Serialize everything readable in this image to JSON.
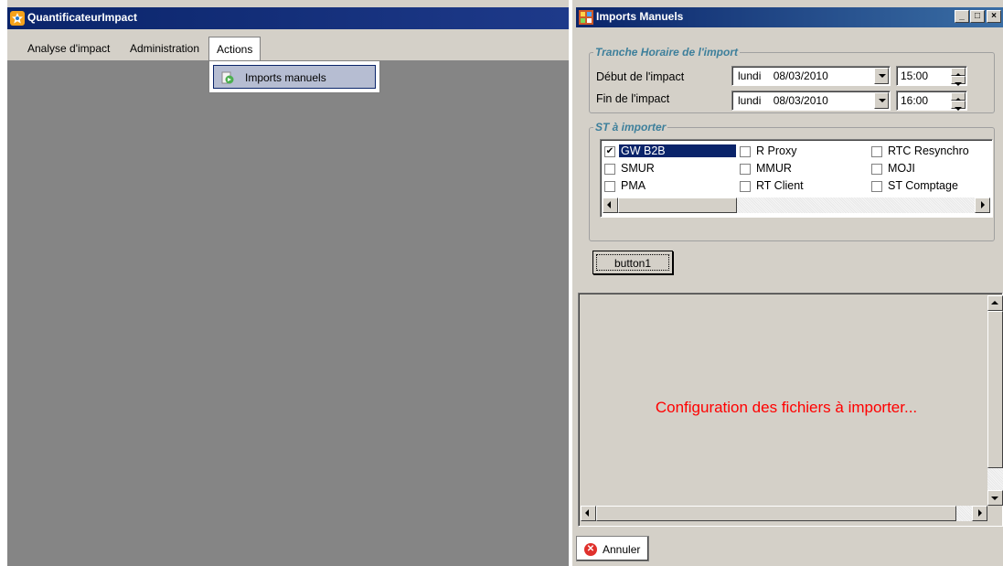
{
  "main_window": {
    "title": "QuantificateurImpact",
    "menu": [
      {
        "label": "Analyse d'impact"
      },
      {
        "label": "Administration"
      },
      {
        "label": "Actions"
      }
    ],
    "actions_menu": {
      "items": [
        {
          "label": "Imports manuels",
          "icon": "import-arrow-icon"
        }
      ]
    }
  },
  "dialog": {
    "title": "Imports Manuels",
    "caption_buttons": {
      "minimize": "_",
      "maximize": "□",
      "close": "×"
    },
    "time_group": {
      "legend": "Tranche Horaire de l'import",
      "start_label": "Début de l'impact",
      "start_date": "lundi    08/03/2010",
      "start_time": "15:00",
      "end_label": "Fin de l'impact",
      "end_date": "lundi    08/03/2010",
      "end_time": "16:00"
    },
    "st_group": {
      "legend": "ST à importer",
      "items": [
        {
          "label": "GW B2B",
          "checked": true,
          "selected": true
        },
        {
          "label": "R Proxy",
          "checked": false
        },
        {
          "label": "RTC Resynchro",
          "checked": false
        },
        {
          "label": "SMUR",
          "checked": false
        },
        {
          "label": "MMUR",
          "checked": false
        },
        {
          "label": "MOJI",
          "checked": false
        },
        {
          "label": "PMA",
          "checked": false
        },
        {
          "label": "RT Client",
          "checked": false
        },
        {
          "label": "ST Comptage",
          "checked": false
        }
      ]
    },
    "button1_label": "button1",
    "message": "Configuration des fichiers à importer...",
    "cancel_label": "Annuler",
    "colors": {
      "message": "#ff0000",
      "title_bar": "#0a246a",
      "legend": "#3d7f9b",
      "selection": "#0a246a"
    }
  }
}
